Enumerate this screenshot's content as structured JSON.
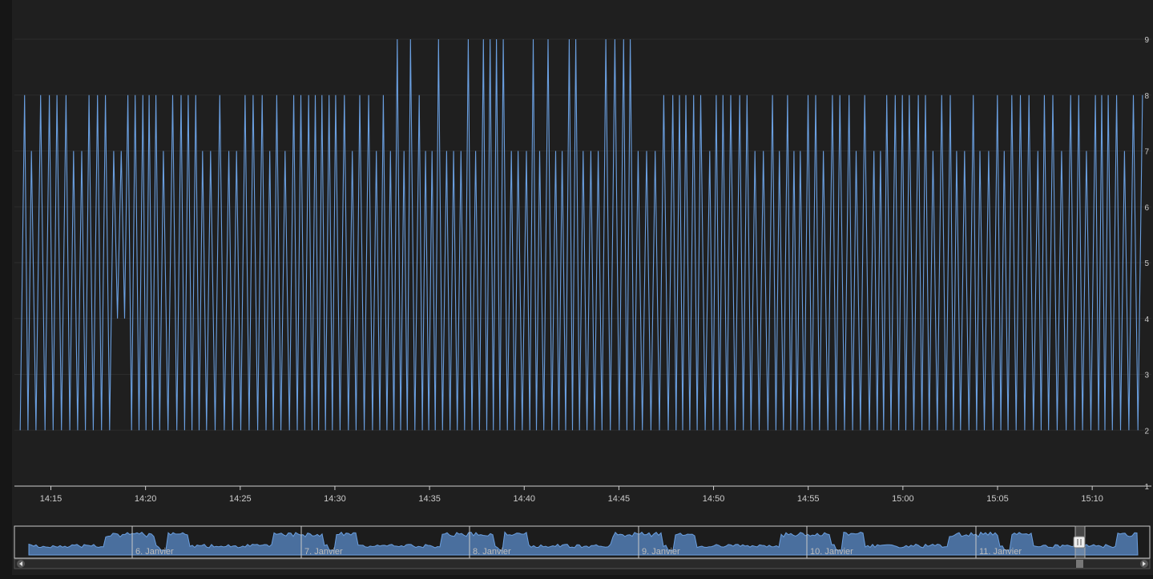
{
  "colors": {
    "background": "#1f1f1f",
    "outer_background": "#161616",
    "series": "#6a9fe0",
    "grid": "#2c2c2c",
    "axis": "#cfcfcf",
    "tick_label": "#cccccc",
    "navigator_fill": "#4a6f9e",
    "navigator_line": "#6a9fe0"
  },
  "chart_data": {
    "type": "line",
    "title": "",
    "xlabel": "",
    "ylabel": "",
    "xlim": [
      "14:13",
      "15:13"
    ],
    "ylim": [
      1,
      9
    ],
    "grid": true,
    "y_ticks": [
      1,
      2,
      3,
      4,
      5,
      6,
      7,
      8,
      9
    ],
    "x_ticks": [
      "14:15",
      "14:20",
      "14:25",
      "14:30",
      "14:35",
      "14:40",
      "14:45",
      "14:50",
      "14:55",
      "15:00",
      "15:05",
      "15:10"
    ],
    "series": [
      {
        "values_summary": "oscillating between a low of 2 and highs of 7 or 8; highs reach 9 between about 14:33 and 14:46",
        "segments": [
          {
            "from": "14:13",
            "to": "14:18",
            "low": 2,
            "high": 8
          },
          {
            "from": "14:18",
            "to": "14:19",
            "low": 4,
            "high": 7
          },
          {
            "from": "14:19",
            "to": "14:33",
            "low": 2,
            "high": 8
          },
          {
            "from": "14:33",
            "to": "14:46",
            "low": 2,
            "high": 9
          },
          {
            "from": "14:46",
            "to": "15:13",
            "low": 2,
            "high": 8
          }
        ]
      }
    ],
    "navigator": {
      "labels": [
        "6. Janvier",
        "7. Janvier",
        "8. Janvier",
        "9. Janvier",
        "10. Janvier",
        "11. Janvier"
      ],
      "selected_range": [
        "14:13",
        "15:13"
      ]
    }
  }
}
